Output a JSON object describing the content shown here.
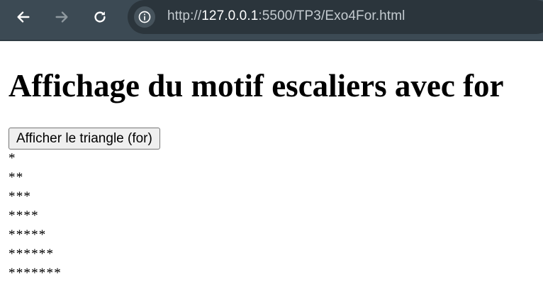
{
  "browser": {
    "url_scheme": "http://",
    "url_host": "127.0.0.1",
    "url_rest": ":5500/TP3/Exo4For.html",
    "icons": {
      "back": "arrow-left-icon",
      "forward": "arrow-right-icon",
      "reload": "reload-icon",
      "site_info": "info-icon"
    },
    "colors": {
      "toolbar": "#3c4a54",
      "omnibox": "#2b353c"
    }
  },
  "page": {
    "title": "Affichage du motif escaliers avec for",
    "button_label": "Afficher le triangle (for)",
    "output_lines": [
      "*",
      "**",
      "***",
      "****",
      "*****",
      "******",
      "*******"
    ]
  }
}
